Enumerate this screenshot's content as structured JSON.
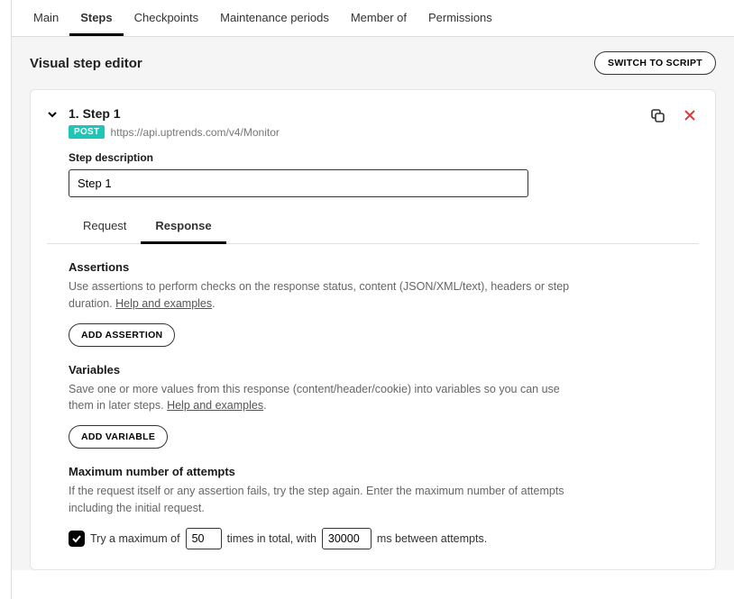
{
  "nav": {
    "tabs": [
      "Main",
      "Steps",
      "Checkpoints",
      "Maintenance periods",
      "Member of",
      "Permissions"
    ],
    "active": "Steps"
  },
  "editor": {
    "title": "Visual step editor",
    "switch_button": "SWITCH TO SCRIPT"
  },
  "step": {
    "title": "1. Step 1",
    "method": "POST",
    "url": "https://api.uptrends.com/v4/Monitor",
    "desc_label": "Step description",
    "desc_value": "Step 1"
  },
  "subtabs": {
    "items": [
      "Request",
      "Response"
    ],
    "active": "Response"
  },
  "assertions": {
    "title": "Assertions",
    "desc_pre": "Use assertions to perform checks on the response status, content (JSON/XML/text), headers or step duration. ",
    "help": "Help and examples",
    "button": "ADD ASSERTION"
  },
  "variables": {
    "title": "Variables",
    "desc_pre": "Save one or more values from this response (content/header/cookie) into variables so you can use them in later steps. ",
    "help": "Help and examples",
    "button": "ADD VARIABLE"
  },
  "attempts": {
    "title": "Maximum number of attempts",
    "desc": "If the request itself or any assertion fails, try the step again. Enter the maximum number of attempts including the initial request.",
    "check_label_1": "Try a maximum of",
    "value_times": "50",
    "check_label_2": "times in total, with",
    "value_ms": "30000",
    "check_label_3": "ms between attempts."
  }
}
